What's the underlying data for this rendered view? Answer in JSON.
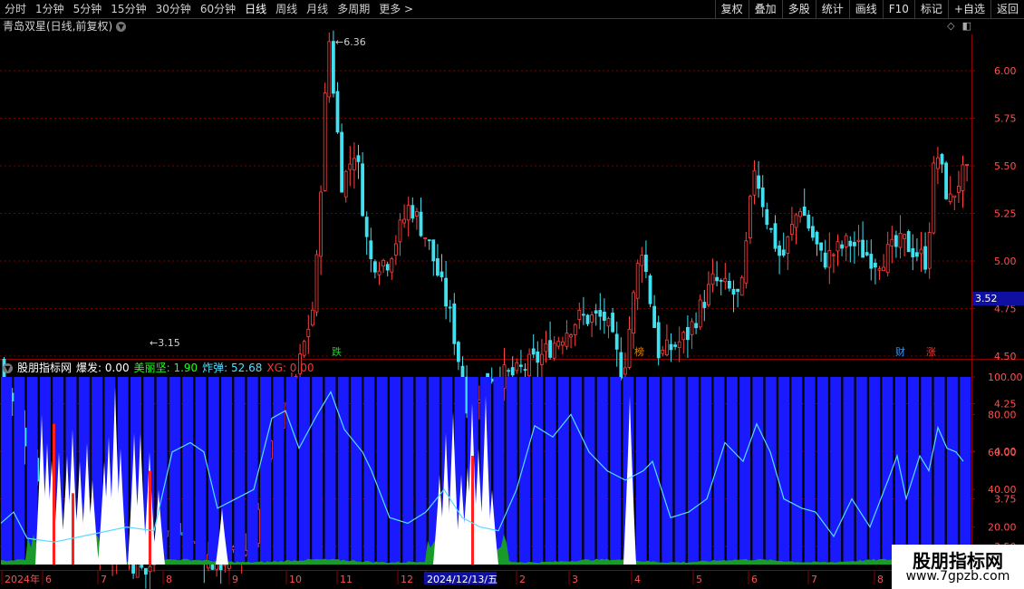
{
  "toolbar": {
    "periods": [
      "分时",
      "1分钟",
      "5分钟",
      "15分钟",
      "30分钟",
      "60分钟",
      "日线",
      "周线",
      "月线",
      "多周期",
      "更多 >"
    ],
    "active_period": "日线",
    "actions": [
      "复权",
      "叠加",
      "多股",
      "统计",
      "画线",
      "F10",
      "标记",
      "+自选",
      "返回"
    ]
  },
  "main_chart": {
    "title": "青岛双星(日线,前复权)",
    "price_ticks": [
      "6.00",
      "5.75",
      "5.50",
      "5.25",
      "5.00",
      "4.75",
      "4.50",
      "4.25",
      "4.00",
      "3.75",
      "3.50"
    ],
    "current_price": "3.52",
    "high_label": "6.36",
    "low_label": "3.15",
    "markers": [
      "跌",
      "榜",
      "财",
      "涨"
    ]
  },
  "indicator": {
    "name": "股朋指标网",
    "fields": [
      {
        "label": "爆发:",
        "value": "0.00",
        "color": "#ffffff"
      },
      {
        "label": "美丽坚:",
        "value": "1.90",
        "color": "#22ff22"
      },
      {
        "label": "炸弹:",
        "value": "52.68",
        "color": "#55ddff"
      },
      {
        "label": "XG:",
        "value": "0.00",
        "color": "#ff3333"
      }
    ],
    "ticks": [
      "100.00",
      "80.00",
      "60.00",
      "40.00",
      "20.00"
    ]
  },
  "time_axis": {
    "labels": [
      "2024年",
      "6",
      "7",
      "8",
      "9",
      "10",
      "11",
      "12",
      "2024/12/13/五",
      "2",
      "3",
      "4",
      "5",
      "6",
      "7",
      "8"
    ]
  },
  "watermark": {
    "title": "股朋指标网",
    "url": "www.7gpzb.com"
  },
  "colors": {
    "up": "#ff4040",
    "down": "#40e0f0",
    "indicator_bg": "#1a1aff",
    "grid": "#8b0000"
  }
}
